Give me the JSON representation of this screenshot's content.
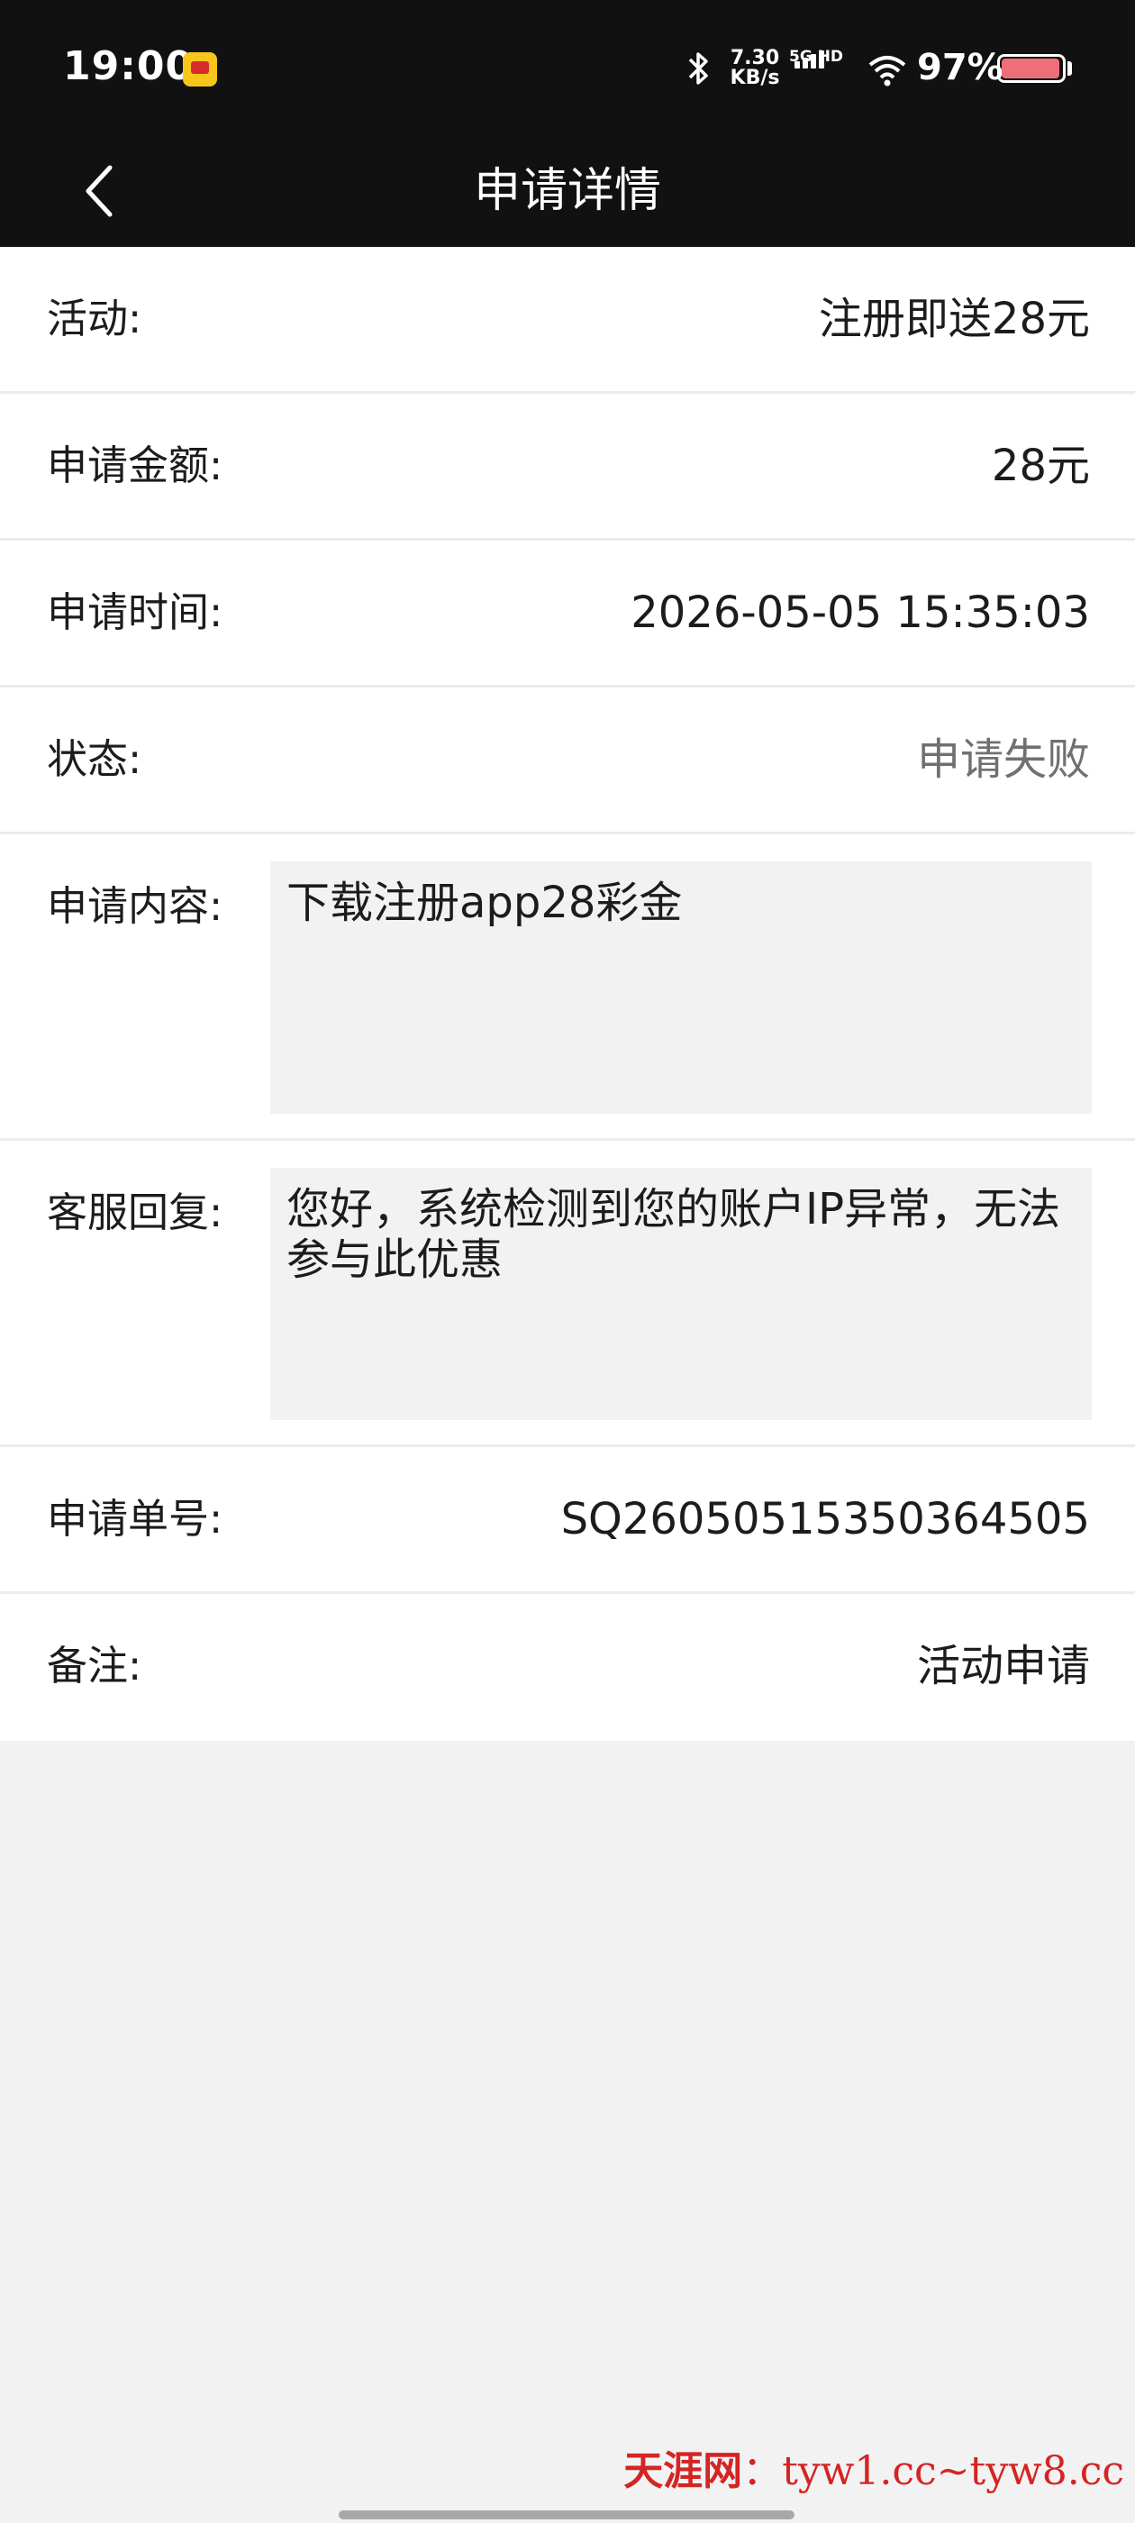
{
  "status_bar": {
    "time": "19:00",
    "net_speed_value": "7.30",
    "net_speed_unit": "KB/s",
    "network_type": "5G HD",
    "battery_percent": "97%",
    "battery_level": 0.97,
    "icons": [
      "app-notification-icon",
      "bluetooth-icon",
      "signal-icon",
      "wifi-icon",
      "battery-icon"
    ]
  },
  "nav": {
    "title": "申请详情",
    "back_icon": "chevron-left-icon"
  },
  "details": {
    "activity": {
      "label": "活动:",
      "value": "注册即送28元"
    },
    "amount": {
      "label": "申请金额:",
      "value": "28元"
    },
    "time": {
      "label": "申请时间:",
      "value": "2026-05-05 15:35:03"
    },
    "status": {
      "label": "状态:",
      "value": "申请失败"
    },
    "content": {
      "label": "申请内容:",
      "value": "下载注册app28彩金"
    },
    "reply": {
      "label": "客服回复:",
      "value": "您好，系统检测到您的账户IP异常，无法参与此优惠"
    },
    "order_no": {
      "label": "申请单号:",
      "value": "SQ26050515350364505"
    },
    "remark": {
      "label": "备注:",
      "value": "活动申请"
    }
  },
  "watermark": {
    "site": "天涯网",
    "separator": "：",
    "urls": "tyw1.cc~tyw8.cc"
  },
  "colors": {
    "header_bg": "#111111",
    "page_bg": "#f2f2f2",
    "status_failed": "#707070",
    "watermark": "#d42424"
  }
}
